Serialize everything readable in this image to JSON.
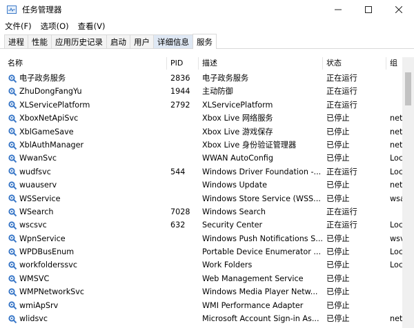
{
  "window": {
    "title": "任务管理器"
  },
  "menu": [
    "文件(F)",
    "选项(O)",
    "查看(V)"
  ],
  "tabs": [
    {
      "label": "进程"
    },
    {
      "label": "性能"
    },
    {
      "label": "应用历史记录"
    },
    {
      "label": "启动"
    },
    {
      "label": "用户"
    },
    {
      "label": "详细信息"
    },
    {
      "label": "服务",
      "active": true
    }
  ],
  "columns": {
    "name": "名称",
    "pid": "PID",
    "desc": "描述",
    "status": "状态",
    "group": "组"
  },
  "services": [
    {
      "name": "电子政务服务",
      "pid": "2836",
      "desc": "电子政务服务",
      "status": "正在运行",
      "group": ""
    },
    {
      "name": "ZhuDongFangYu",
      "pid": "1944",
      "desc": "主动防御",
      "status": "正在运行",
      "group": ""
    },
    {
      "name": "XLServicePlatform",
      "pid": "2792",
      "desc": "XLServicePlatform",
      "status": "正在运行",
      "group": ""
    },
    {
      "name": "XboxNetApiSvc",
      "pid": "",
      "desc": "Xbox Live 网络服务",
      "status": "已停止",
      "group": "net"
    },
    {
      "name": "XblGameSave",
      "pid": "",
      "desc": "Xbox Live 游戏保存",
      "status": "已停止",
      "group": "net"
    },
    {
      "name": "XblAuthManager",
      "pid": "",
      "desc": "Xbox Live 身份验证管理器",
      "status": "已停止",
      "group": "net"
    },
    {
      "name": "WwanSvc",
      "pid": "",
      "desc": "WWAN AutoConfig",
      "status": "已停止",
      "group": "Loc"
    },
    {
      "name": "wudfsvc",
      "pid": "544",
      "desc": "Windows Driver Foundation -...",
      "status": "正在运行",
      "group": "Loc"
    },
    {
      "name": "wuauserv",
      "pid": "",
      "desc": "Windows Update",
      "status": "已停止",
      "group": "net"
    },
    {
      "name": "WSService",
      "pid": "",
      "desc": "Windows Store Service (WSS...",
      "status": "已停止",
      "group": "wsa"
    },
    {
      "name": "WSearch",
      "pid": "7028",
      "desc": "Windows Search",
      "status": "正在运行",
      "group": ""
    },
    {
      "name": "wscsvc",
      "pid": "632",
      "desc": "Security Center",
      "status": "正在运行",
      "group": "Loc"
    },
    {
      "name": "WpnService",
      "pid": "",
      "desc": "Windows Push Notifications S...",
      "status": "已停止",
      "group": "wsv"
    },
    {
      "name": "WPDBusEnum",
      "pid": "",
      "desc": "Portable Device Enumerator ...",
      "status": "已停止",
      "group": "Loc"
    },
    {
      "name": "workfolderssvc",
      "pid": "",
      "desc": "Work Folders",
      "status": "已停止",
      "group": "Loc"
    },
    {
      "name": "WMSVC",
      "pid": "",
      "desc": "Web Management Service",
      "status": "已停止",
      "group": ""
    },
    {
      "name": "WMPNetworkSvc",
      "pid": "",
      "desc": "Windows Media Player Netw...",
      "status": "已停止",
      "group": ""
    },
    {
      "name": "wmiApSrv",
      "pid": "",
      "desc": "WMI Performance Adapter",
      "status": "已停止",
      "group": ""
    },
    {
      "name": "wlidsvc",
      "pid": "",
      "desc": "Microsoft Account Sign-in As...",
      "status": "已停止",
      "group": "net"
    }
  ],
  "icons": {
    "window_controls": [
      "minimize-icon",
      "maximize-icon",
      "close-icon"
    ],
    "service": "gear-icon"
  },
  "colors": {
    "tab_highlight": "#dfe8f4",
    "icon_blue": "#3a78c8"
  }
}
